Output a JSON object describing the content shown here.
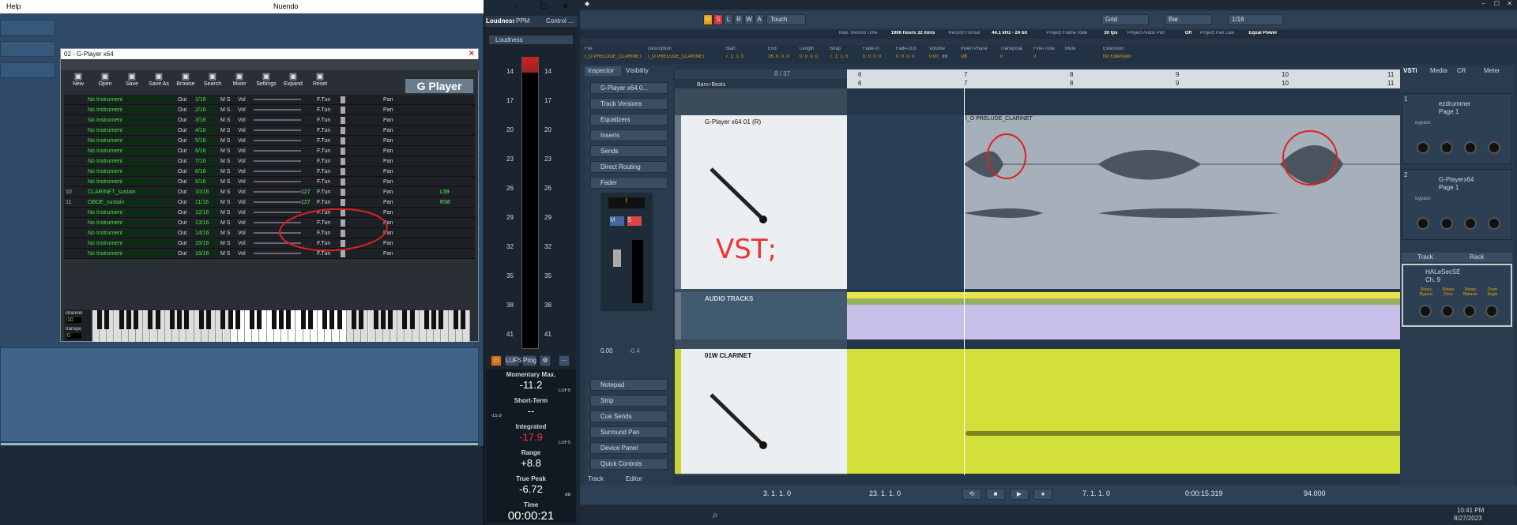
{
  "left_window": {
    "menu_help": "Help",
    "title": "Nuendo",
    "controls": [
      "–",
      "☐",
      "✕"
    ]
  },
  "gplayer": {
    "title": "02 - G-Player x64",
    "toolbar": [
      "New",
      "Open",
      "Save",
      "Save As",
      "Browse",
      "Search",
      "Mixer",
      "Settings",
      "Expand",
      "Reset"
    ],
    "logo": "G Player",
    "rows": [
      {
        "n": "",
        "inst": "No Instrument",
        "out": "Out",
        "num": "1/16"
      },
      {
        "n": "",
        "inst": "No Instrument",
        "out": "Out",
        "num": "2/16"
      },
      {
        "n": "",
        "inst": "No Instrument",
        "out": "Out",
        "num": "3/16"
      },
      {
        "n": "",
        "inst": "No Instrument",
        "out": "Out",
        "num": "4/16"
      },
      {
        "n": "",
        "inst": "No Instrument",
        "out": "Out",
        "num": "5/16"
      },
      {
        "n": "",
        "inst": "No Instrument",
        "out": "Out",
        "num": "6/16"
      },
      {
        "n": "",
        "inst": "No Instrument",
        "out": "Out",
        "num": "7/16"
      },
      {
        "n": "",
        "inst": "No Instrument",
        "out": "Out",
        "num": "8/16"
      },
      {
        "n": "",
        "inst": "No Instrument",
        "out": "Out",
        "num": "9/16"
      },
      {
        "n": "10",
        "inst": "CLARINET_sustain",
        "out": "Out",
        "num": "10/16"
      },
      {
        "n": "11",
        "inst": "OBOE_sustain",
        "out": "Out",
        "num": "11/16"
      },
      {
        "n": "",
        "inst": "No Instrument",
        "out": "Out",
        "num": "12/16"
      },
      {
        "n": "",
        "inst": "No Instrument",
        "out": "Out",
        "num": "13/16"
      },
      {
        "n": "",
        "inst": "No Instrument",
        "out": "Out",
        "num": "14/16"
      },
      {
        "n": "",
        "inst": "No Instrument",
        "out": "Out",
        "num": "15/16"
      },
      {
        "n": "",
        "inst": "No Instrument",
        "out": "Out",
        "num": "16/16"
      }
    ],
    "vol_label": "Vol",
    "ftun": "F.Tun",
    "pan": "Pan",
    "ms": "M S",
    "vol10": "127",
    "vol11": "127",
    "pan10": "L59",
    "pan11": "R38",
    "channel_label": "channel",
    "channel_val": "10",
    "transpo_label": "transpo",
    "transpo_val": "0"
  },
  "loudness": {
    "tabs": [
      "Loudness",
      "PPM",
      "Control ..."
    ],
    "header": "Loudness",
    "scale": [
      "14",
      "17",
      "20",
      "23",
      "26",
      "29",
      "32",
      "35",
      "38",
      "41"
    ],
    "buttons": [
      "LUFS",
      "Prog"
    ],
    "momentary_label": "Momentary Max.",
    "momentary": "-11.2",
    "shortterm_label": "Short-Term",
    "shortterm": "--",
    "shortterm_min": "-15.9",
    "integrated_label": "Integrated",
    "integrated": "-17.9",
    "range_label": "Range",
    "range": "+8.8",
    "truepeak_label": "True Peak",
    "truepeak": "-6.72",
    "time_label": "Time",
    "time": "00:00:21",
    "unit": "LUFS",
    "unit_db": "dB"
  },
  "nuendo": {
    "toolbar": {
      "modes": [
        "M",
        "S",
        "L",
        "R",
        "W",
        "A"
      ],
      "automation": "Touch",
      "grid": "Grid",
      "bar": "Bar",
      "quant": "1/16"
    },
    "status": [
      "Max. Record Time",
      "1906 hours 32 mins",
      "Record Format",
      "44.1 kHz - 24 bit",
      "Project Frame Rate",
      "30 fps",
      "Project Audio Pull",
      "Off",
      "Project Pan Law",
      "Equal Power"
    ],
    "info_headers": [
      "File",
      "Description",
      "Start",
      "End",
      "Length",
      "Snap",
      "Fade-In",
      "Fade-Out",
      "Volume",
      "Invert Phase",
      "Transpose",
      "Fine-Tune",
      "Mute",
      "Extension"
    ],
    "info_values": [
      "I_O PRELUDE_CLARINET",
      "I_O PRELUDE_CLARINET",
      "7. 1. 1. 0",
      "16. 0. 0. 0",
      "0. 0. 0. 0",
      "7. 1. 1. 0",
      "0. 0. 0. 0",
      "0. 0. 0. 0",
      "0.00",
      "Off",
      "0",
      "0",
      "",
      "No Extension"
    ],
    "info_unit": "dB",
    "inspector_tabs": [
      "Inspector",
      "Visibility"
    ],
    "inspector_track": "G-Player x64 0...",
    "inspector_sections": [
      "Track Versions",
      "Equalizers",
      "Inserts",
      "Sends",
      "Direct Routing",
      "Fader"
    ],
    "inspector_lower": [
      "Notepad",
      "Strip",
      "Cue Sends",
      "Surround Pan",
      "Device Panel",
      "Quick Controls"
    ],
    "fader_vals": [
      "0.00",
      "-0.4"
    ],
    "bottom_tabs": [
      "Track",
      "Editor"
    ],
    "track_count": "8 / 37",
    "ruler_label": "Bars+Beats",
    "ruler": [
      "6",
      "7",
      "8",
      "9",
      "10",
      "11"
    ],
    "tracks": [
      {
        "name": "G-Player x64 01 (R)",
        "region": "I_O PRELUDE_CLARINET",
        "annotation": "VST;"
      },
      {
        "name": "AUDIO TRACKS"
      },
      {
        "name": "01W CLARINET"
      }
    ],
    "rightzone_tabs": [
      "VSTi",
      "Media",
      "CR",
      "Meter"
    ],
    "instruments": [
      {
        "slot": "1",
        "name": "ezdrummer",
        "page": "Page 1",
        "bypass": "Bypass"
      },
      {
        "slot": "2",
        "name": "G-Playerx64",
        "page": "Page 1",
        "bypass": "Bypass"
      }
    ],
    "track_rack": [
      "Track",
      "Rack"
    ],
    "insert": {
      "slot": "1",
      "name": "HALeSecSE",
      "ch": "Ch. 9",
      "knobs": [
        "Rotary Bypass",
        "Rotary Drive",
        "Rotary Balance",
        "Drum Angle"
      ]
    },
    "transport": {
      "left_locator": "3. 1. 1. 0",
      "right_locator": "23. 1. 1. 0",
      "position": "7. 1. 1. 0",
      "time": "0:00:15.319",
      "tempo": "94.000"
    },
    "clock": {
      "time": "10:41 PM",
      "date": "8/27/2023"
    }
  }
}
